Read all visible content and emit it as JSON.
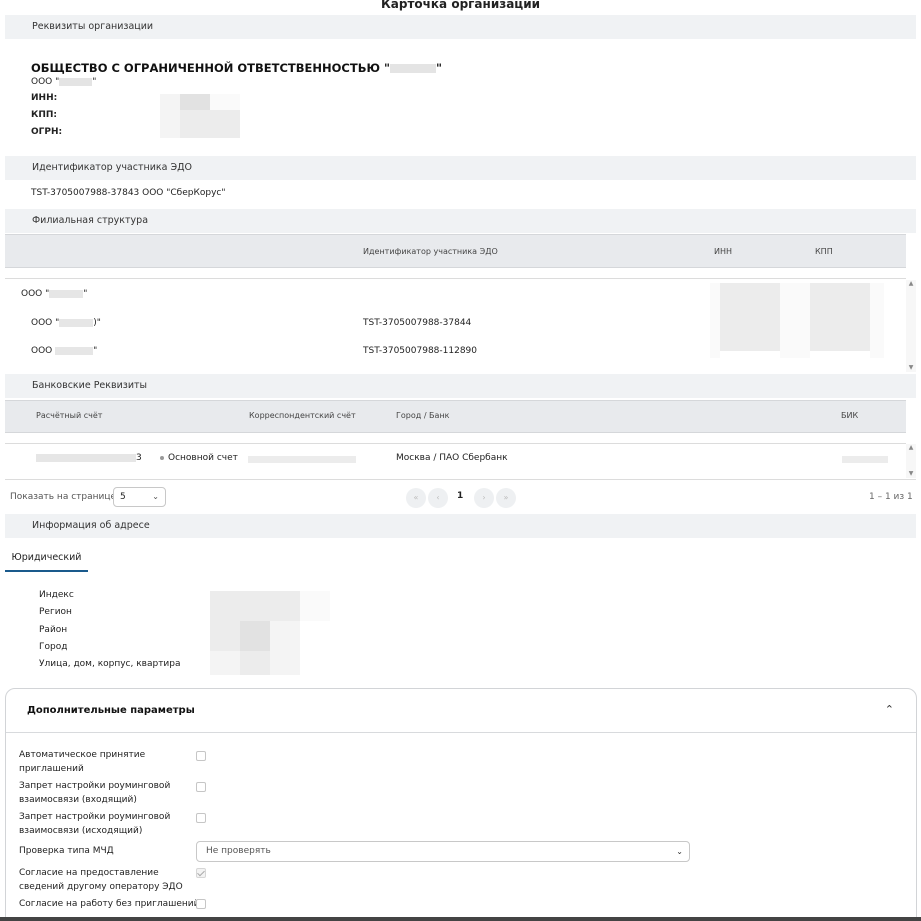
{
  "page": {
    "title": "Карточка организации"
  },
  "requisites": {
    "section_title": "Реквизиты организации",
    "full_name": "ОБЩЕСТВО С ОГРАНИЧЕННОЙ ОТВЕТСТВЕННОСТЬЮ \"",
    "full_name_suffix": "\"",
    "short_name_prefix": "ООО \"",
    "short_name_suffix": "\"",
    "inn_label": "ИНН:",
    "kpp_label": "КПП:",
    "ogrn_label": "ОГРН:"
  },
  "edo": {
    "section_title": "Идентификатор участника ЭДО",
    "value": "TST-3705007988-37843 ООО \"СберКорус\""
  },
  "branches": {
    "section_title": "Филиальная структура",
    "columns": [
      "Идентификатор участника ЭДО",
      "ИНН",
      "КПП"
    ],
    "rows": [
      {
        "name_prefix": "ООО \"",
        "name_suffix": "\"",
        "edo": ""
      },
      {
        "name_prefix": "ООО \"",
        "name_suffix": ")\"",
        "edo": "TST-3705007988-37844"
      },
      {
        "name_prefix": "ООО ",
        "name_suffix": "\"",
        "edo": "TST-3705007988-112890"
      }
    ]
  },
  "bank": {
    "section_title": "Банковские Реквизиты",
    "columns": [
      "Расчётный счёт",
      "Корреспондентский счёт",
      "Город / Банк",
      "БИК"
    ],
    "row": {
      "account_suffix": "3",
      "badge": "Основной счет",
      "city_bank": "Москва / ПАО Сбербанк"
    },
    "pager": {
      "per_page_label": "Показать на странице:",
      "per_page_value": "5",
      "current_page": "1",
      "range": "1 – 1 из 1"
    }
  },
  "address": {
    "section_title": "Информация об адресе",
    "tab": "Юридический",
    "fields": [
      "Индекс",
      "Регион",
      "Район",
      "Город",
      "Улица, дом, корпус, квартира"
    ]
  },
  "extra": {
    "title": "Дополнительные параметры",
    "options": [
      {
        "label": "Автоматическое принятие приглашений",
        "checked": false
      },
      {
        "label": "Запрет настройки роуминговой взаимосвязи (входящий)",
        "checked": false
      },
      {
        "label": "Запрет настройки роуминговой взаимосвязи (исходящий)",
        "checked": false
      },
      {
        "label": "Согласие на предоставление сведений другому оператору ЭДО",
        "checked": true
      },
      {
        "label": "Согласие на работу без приглашений",
        "checked": false
      }
    ],
    "mchd_label": "Проверка типа МЧД",
    "mchd_value": "Не проверять"
  }
}
